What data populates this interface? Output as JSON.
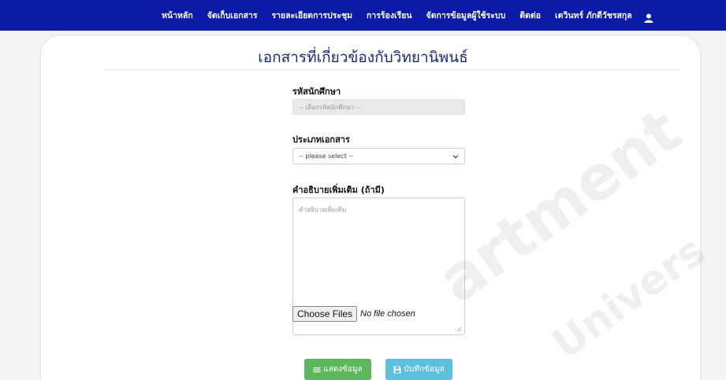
{
  "nav": {
    "items": [
      "หน้าหลัก",
      "จัดเก็บเอกสาร",
      "รายละเอียดการประชุม",
      "การร้องเรียน",
      "จัดการข้อมูลผู้ใช้ระบบ",
      "ติดต่อ",
      "เตวินทร์ ภักดีวัชรสกุล"
    ],
    "user_icon": "user-icon"
  },
  "form": {
    "title": "เอกสารที่เกี่ยวข้องกับวิทยานิพนธ์",
    "student_id": {
      "label": "รหัสนักศึกษา",
      "placeholder": "-- เลือกรหัสนักศึกษา --"
    },
    "doc_type": {
      "label": "ประเภทเอกสาร",
      "selected": "-- please select --"
    },
    "description": {
      "label": "คำอธิบายเพิ่มเติม (ถ้ามี)",
      "placeholder": "คำอธิบายเพิ่มเติม"
    },
    "file": {
      "button_label": "Choose Files",
      "status": "No file chosen"
    },
    "buttons": {
      "show_label": "แสดงข้อมูล",
      "save_label": "บันทึกข้อมูล",
      "show_color": "#5cb85c",
      "save_color": "#5bc0de"
    }
  },
  "watermark": {
    "line1": "artment",
    "line2": "Univers"
  },
  "colors": {
    "navbar": "#0c1aa8",
    "title": "#1a2a78"
  }
}
